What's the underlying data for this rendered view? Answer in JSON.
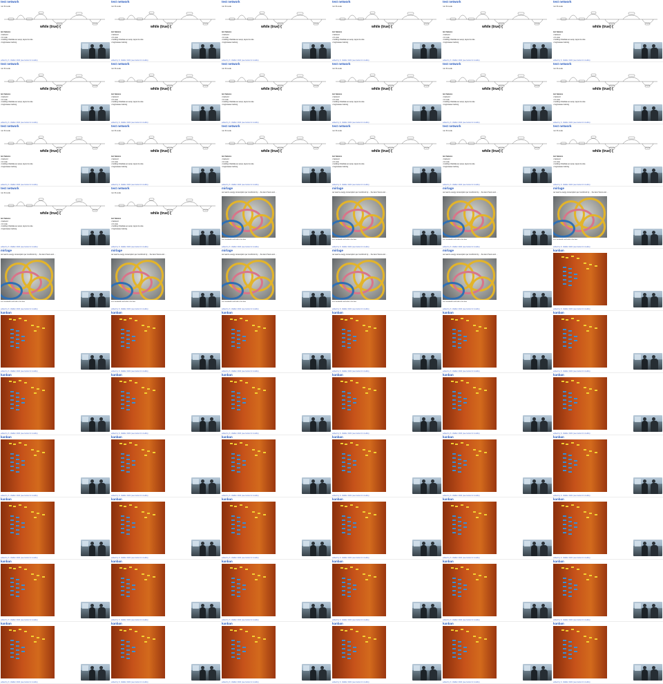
{
  "slides_regexp": {
    "title": "test network",
    "subtitle": "run:R-node",
    "loop_text": "while (true) {",
    "bullets_head": "test features",
    "bullets": [
      "backend",
      "UI code",
      "building infra/data set setup, layout & code",
      "bug/release tracking"
    ],
    "footer": "edited by K. Vakiller 2022 (see below for credits)"
  },
  "slides_cables": {
    "title": "mirlage",
    "caption": "our team's energy consumption per month/unit by ... the last 2 hours and ...",
    "note": "test: bandwidth and build in the data",
    "footer": "edited by K. Vakiller 2022 (see below for credits)"
  },
  "slides_kanban": {
    "title": "kanban",
    "footer": "edited by K. Vakiller 2022 (see below for credits)"
  },
  "layout_counts": {
    "regexp": 20,
    "cables": 9,
    "kanban": 37
  },
  "colors": {
    "title_blue": "#2255bb",
    "cable_yellow": "#e3b429",
    "kanban_orange": "#c6521a"
  }
}
